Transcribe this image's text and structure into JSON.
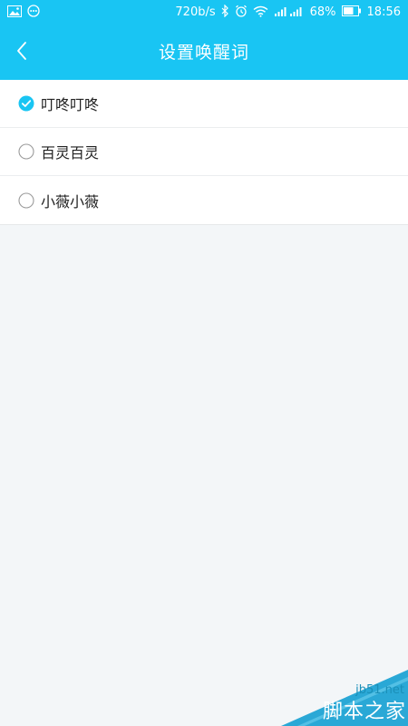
{
  "status_bar": {
    "net_speed": "720b/s",
    "battery": "68%",
    "time": "18:56",
    "icons": [
      "image-icon",
      "more-icon",
      "bluetooth-icon",
      "alarm-icon",
      "wifi-icon",
      "signal-icon",
      "battery-icon"
    ]
  },
  "app_bar": {
    "title": "设置唤醒词",
    "back_icon": "chevron-left-icon"
  },
  "options": [
    {
      "label": "叮咚叮咚",
      "selected": true
    },
    {
      "label": "百灵百灵",
      "selected": false
    },
    {
      "label": "小薇小薇",
      "selected": false
    }
  ],
  "watermark": {
    "site": "jb51.net",
    "name": "脚本之家"
  },
  "colors": {
    "primary": "#19c5f3",
    "background": "#f3f6f8",
    "text": "#222222"
  }
}
